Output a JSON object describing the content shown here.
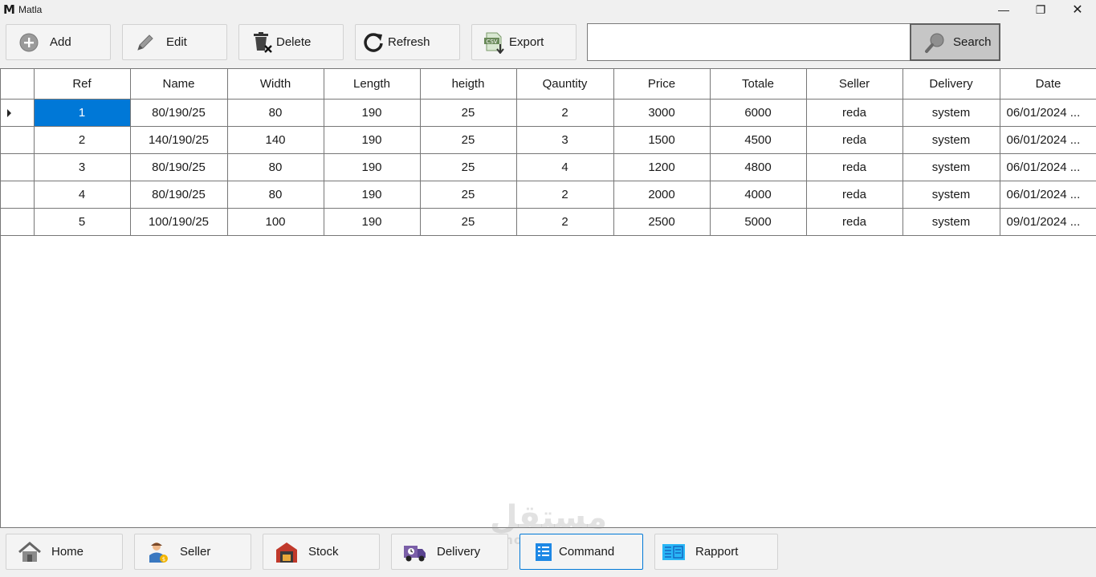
{
  "window": {
    "logo": "M",
    "title": "Matla",
    "minimize": "—",
    "maximize": "❐",
    "close": "✕"
  },
  "toolbar": {
    "add": "Add",
    "edit": "Edit",
    "delete": "Delete",
    "refresh": "Refresh",
    "export": "Export",
    "export_badge": "CSV",
    "search_value": "",
    "search": "Search"
  },
  "table": {
    "columns": [
      "Ref",
      "Name",
      "Width",
      "Length",
      "heigth",
      "Qauntity",
      "Price",
      "Totale",
      "Seller",
      "Delivery",
      "Date"
    ],
    "rows": [
      [
        "1",
        "80/190/25",
        "80",
        "190",
        "25",
        "2",
        "3000",
        "6000",
        "reda",
        "system",
        "06/01/2024 ..."
      ],
      [
        "2",
        "140/190/25",
        "140",
        "190",
        "25",
        "3",
        "1500",
        "4500",
        "reda",
        "system",
        "06/01/2024 ..."
      ],
      [
        "3",
        "80/190/25",
        "80",
        "190",
        "25",
        "4",
        "1200",
        "4800",
        "reda",
        "system",
        "06/01/2024 ..."
      ],
      [
        "4",
        "80/190/25",
        "80",
        "190",
        "25",
        "2",
        "2000",
        "4000",
        "reda",
        "system",
        "06/01/2024 ..."
      ],
      [
        "5",
        "100/190/25",
        "100",
        "190",
        "25",
        "2",
        "2500",
        "5000",
        "reda",
        "system",
        "09/01/2024 ..."
      ]
    ],
    "selected_row": 0
  },
  "nav": {
    "home": "Home",
    "seller": "Seller",
    "stock": "Stock",
    "delivery": "Delivery",
    "command": "Command",
    "rapport": "Rapport",
    "active": "command"
  },
  "watermark": {
    "main": "مستقل",
    "sub": "mostaql.com"
  },
  "colors": {
    "selection": "#0078d7",
    "background": "#f0f0f0",
    "grid_line": "#777777",
    "search_button": "#c6c6c6"
  }
}
